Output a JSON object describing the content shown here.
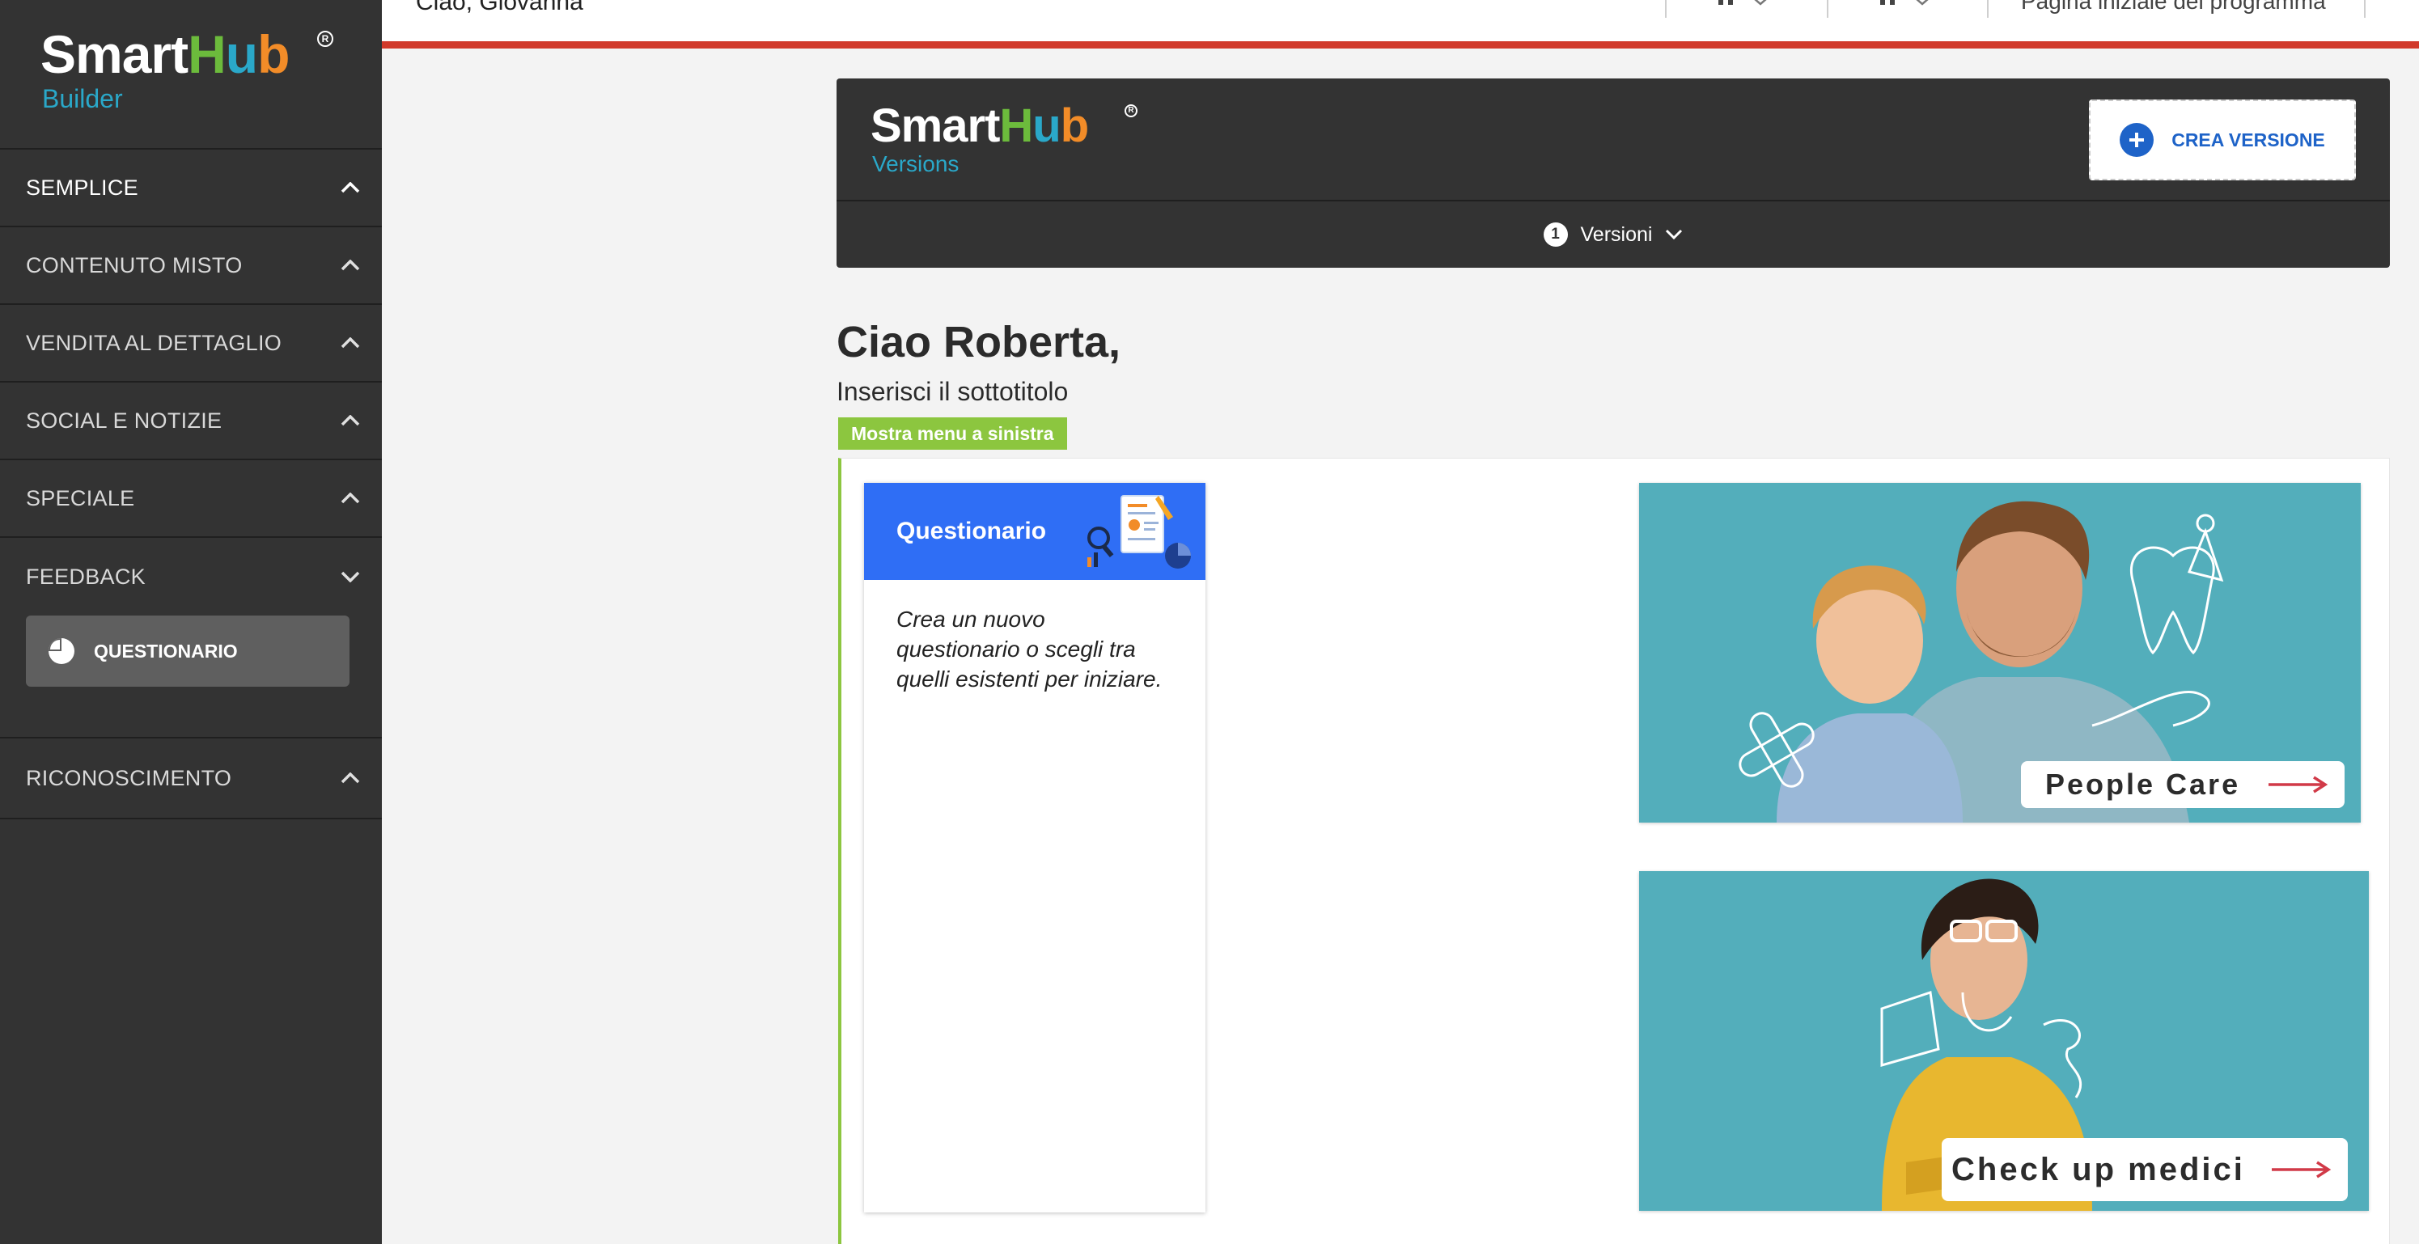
{
  "app": {
    "logo": {
      "smart": "Smart",
      "hub_h": "H",
      "hub_u": "u",
      "hub_b": "b",
      "reg": "R",
      "sub": "Builder"
    }
  },
  "sidebar": {
    "items": [
      {
        "label": "SEMPLICE",
        "state": "active",
        "chevron": "up"
      },
      {
        "label": "CONTENUTO MISTO",
        "chevron": "up"
      },
      {
        "label": "VENDITA AL DETTAGLIO",
        "chevron": "up"
      },
      {
        "label": "SOCIAL E NOTIZIE",
        "chevron": "up"
      },
      {
        "label": "SPECIALE",
        "chevron": "up"
      },
      {
        "label": "FEEDBACK",
        "chevron": "down"
      },
      {
        "label": "RICONOSCIMENTO",
        "chevron": "up"
      }
    ],
    "feedback_sub": {
      "label": "QUESTIONARIO",
      "icon": "pie-chart-icon"
    }
  },
  "topbar": {
    "greeting": "Ciao, Giovanna",
    "home_link": "Pagina iniziale del programma"
  },
  "versions": {
    "logo": {
      "smart": "Smart",
      "hub_h": "H",
      "hub_u": "u",
      "hub_b": "b",
      "reg": "R",
      "sub": "Versions"
    },
    "create_button": "CREA VERSIONE",
    "count": "1",
    "label": "Versioni"
  },
  "page": {
    "title": "Ciao Roberta,",
    "subtitle": "Inserisci il sottotitolo",
    "menu_tag": "Mostra menu a sinistra"
  },
  "questionnaire_card": {
    "title": "Questionario",
    "description": "Crea un nuovo questionario o scegli tra quelli esistenti per iniziare."
  },
  "banners": [
    {
      "label": "People Care"
    },
    {
      "label": "Check up medici"
    }
  ],
  "colors": {
    "sidebar_bg": "#333333",
    "accent_red": "#d13a2b",
    "accent_blue": "#1e63c8",
    "card_blue": "#2f6ef5",
    "tag_green": "#8cc63f",
    "banner_teal": "#53aebb"
  }
}
